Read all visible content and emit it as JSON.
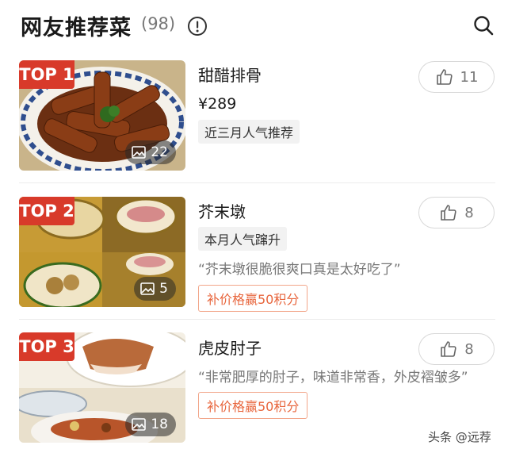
{
  "header": {
    "title": "网友推荐菜",
    "count": "(98)"
  },
  "items": [
    {
      "rank_badge": "TOP 1",
      "name": "甜醋排骨",
      "price": "¥289",
      "tag": "近三月人气推荐",
      "quote": "",
      "promo": "",
      "photo_count": "22",
      "likes": "11"
    },
    {
      "rank_badge": "TOP 2",
      "name": "芥末墩",
      "price": "",
      "tag": "本月人气蹿升",
      "quote": "“芥末墩很脆很爽口真是太好吃了”",
      "promo": "补价格赢50积分",
      "photo_count": "5",
      "likes": "8"
    },
    {
      "rank_badge": "TOP 3",
      "name": "虎皮肘子",
      "price": "",
      "tag": "",
      "quote": "“非常肥厚的肘子，味道非常香，外皮褶皱多”",
      "promo": "补价格赢50积分",
      "photo_count": "18",
      "likes": "8"
    }
  ],
  "watermark": "头条 @远荐",
  "colors": {
    "badge": "#d83a2a",
    "promo": "#e8663d"
  }
}
